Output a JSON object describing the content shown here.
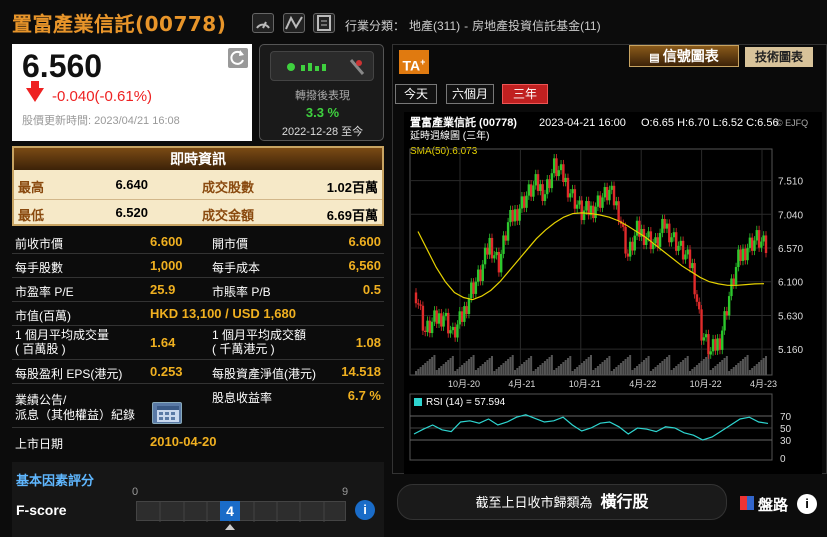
{
  "stock": {
    "name": "置富產業信託",
    "code": "(00778)",
    "price": "6.560",
    "change": "-0.040(-0.61%)",
    "update_label": "股價更新時間:",
    "update_time": "2023/04/21 16:08"
  },
  "industry": {
    "label": "行業分類：",
    "sector": "地產(311)",
    "sep": "-",
    "subsector": "房地產投資信託基金(11)"
  },
  "perf": {
    "label": "轉撥後表現",
    "value": "3.3 %",
    "period": "2022-12-28 至今"
  },
  "realtime": {
    "title": "即時資訊",
    "rows": [
      {
        "l1": "最高",
        "v1": "6.640",
        "l2": "成交股數",
        "v2": "1.02百萬"
      },
      {
        "l1": "最低",
        "v1": "6.520",
        "l2": "成交金額",
        "v2": "6.69百萬"
      }
    ]
  },
  "details": [
    {
      "l1": "前收市價",
      "v1": "6.600",
      "l2": "開市價",
      "v2": "6.600"
    },
    {
      "l1": "每手股數",
      "v1": "1,000",
      "l2": "每手成本",
      "v2": "6,560"
    },
    {
      "l1": "市盈率 P/E",
      "v1": "25.9",
      "l2": "市賬率 P/B",
      "v2": "0.5"
    },
    {
      "l1": "市值(百萬)",
      "v1": "HKD 13,100 / USD 1,680",
      "l2": "",
      "v2": ""
    },
    {
      "l1": "1 個月平均成交量\n( 百萬股 )",
      "v1": "1.64",
      "l2": "1 個月平均成交額\n( 千萬港元 )",
      "v2": "1.08"
    },
    {
      "l1": "每股盈利 EPS(港元)",
      "v1": "0.253",
      "l2": "每股資產淨值(港元)",
      "v2": "14.518"
    },
    {
      "l1": "業績公告/\n派息（其他權益）紀錄",
      "v1": "",
      "l2": "股息收益率",
      "v2": "6.7 %"
    },
    {
      "l1": "上市日期",
      "v1": "2010-04-20",
      "l2": "",
      "v2": ""
    }
  ],
  "fscore": {
    "title": "基本因素評分",
    "name": "F-score",
    "min": "0",
    "max": "9",
    "value": "4",
    "info": "i"
  },
  "chart": {
    "ta": "TA",
    "tab_signal": "信號圖表",
    "tab_tech": "技術圖表",
    "ranges": [
      "今天",
      "六個月",
      "三年"
    ],
    "active_range": "三年",
    "title": "置富產業信託 (00778)",
    "date": "2023-04-21 16:00",
    "ohlc": "O:6.65 H:6.70 L:6.52 C:6.56",
    "subtitle": "延時週線圖 (三年)",
    "sma": "SMA(50):6.073",
    "copyright": "© EJFQ",
    "rsi_label": "RSI (14) = 57.594"
  },
  "bottom": {
    "text": "截至上日收市歸類為",
    "class": "橫行股",
    "panlu": "盤路",
    "info": "i"
  },
  "chart_data": {
    "type": "line",
    "title": "置富產業信託 (00778)",
    "subtitle": "延時週線圖 (三年)",
    "x_ticks": [
      "10月-20",
      "4月-21",
      "10月-21",
      "4月-22",
      "10月-22",
      "4月-23"
    ],
    "y_ticks": [
      7.51,
      7.04,
      6.57,
      6.1,
      5.63,
      5.16
    ],
    "ylim": [
      4.8,
      7.95
    ],
    "series": [
      {
        "name": "Close",
        "values": [
          5.95,
          5.4,
          5.55,
          5.65,
          5.35,
          5.6,
          6.0,
          6.2,
          6.65,
          6.35,
          6.9,
          7.1,
          7.3,
          7.45,
          7.35,
          7.7,
          7.55,
          7.3,
          7.05,
          7.1,
          7.25,
          7.35,
          7.1,
          6.45,
          6.8,
          6.75,
          6.6,
          6.9,
          6.7,
          6.5,
          6.3,
          5.4,
          5.1,
          5.3,
          5.9,
          6.4,
          6.6,
          6.7,
          6.56
        ]
      },
      {
        "name": "SMA(50)",
        "values": [
          6.8,
          6.55,
          6.3,
          6.1,
          5.95,
          5.88,
          5.85,
          5.9,
          5.98,
          6.1,
          6.25,
          6.4,
          6.55,
          6.7,
          6.82,
          6.92,
          7.0,
          7.05,
          7.06,
          7.05,
          7.03,
          7.0,
          6.95,
          6.88,
          6.8,
          6.72,
          6.62,
          6.52,
          6.42,
          6.32,
          6.24,
          6.16,
          6.1,
          6.07,
          6.05,
          6.05,
          6.06,
          6.07,
          6.073
        ]
      }
    ],
    "rsi": {
      "values": [
        40,
        48,
        55,
        47,
        44,
        60,
        62,
        58,
        65,
        55,
        60,
        68,
        72,
        66,
        60,
        62,
        68,
        55,
        45,
        50,
        58,
        60,
        52,
        40,
        50,
        48,
        44,
        52,
        50,
        42,
        38,
        30,
        35,
        45,
        55,
        65,
        68,
        60,
        57.6
      ],
      "ticks": [
        70,
        50,
        30,
        0
      ]
    }
  }
}
